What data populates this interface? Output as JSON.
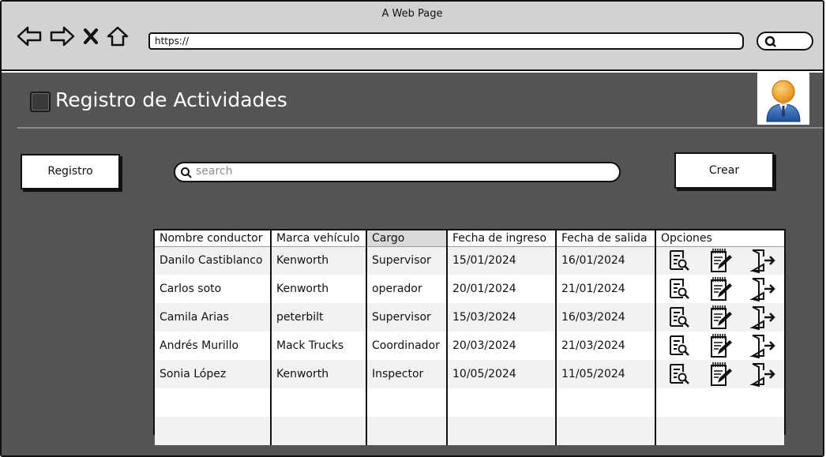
{
  "browser": {
    "title": "A Web Page",
    "url": "https://"
  },
  "app": {
    "title": "Registro de Actividades"
  },
  "toolbar": {
    "registro_label": "Registro",
    "crear_label": "Crear",
    "search_placeholder": "search"
  },
  "table": {
    "headers": [
      "Nombre conductor",
      "Marca vehículo",
      "Cargo",
      "Fecha de ingreso",
      "Fecha de salida",
      "Opciones"
    ],
    "rows": [
      [
        "Danilo Castiblanco",
        "Kenworth",
        "Supervisor",
        "15/01/2024",
        "16/01/2024"
      ],
      [
        "Carlos soto",
        "Kenworth",
        "operador",
        "20/01/2024",
        "21/01/2024"
      ],
      [
        "Camila Arias",
        "peterbilt",
        "Supervisor",
        "15/03/2024",
        "16/03/2024"
      ],
      [
        "Andrés Murillo",
        "Mack Trucks",
        "Coordinador",
        "20/03/2024",
        "21/03/2024"
      ],
      [
        "Sonia López",
        "Kenworth",
        "Inspector",
        "10/05/2024",
        "11/05/2024"
      ]
    ],
    "row_options": [
      "view-details-icon",
      "edit-icon",
      "exit-icon"
    ]
  }
}
